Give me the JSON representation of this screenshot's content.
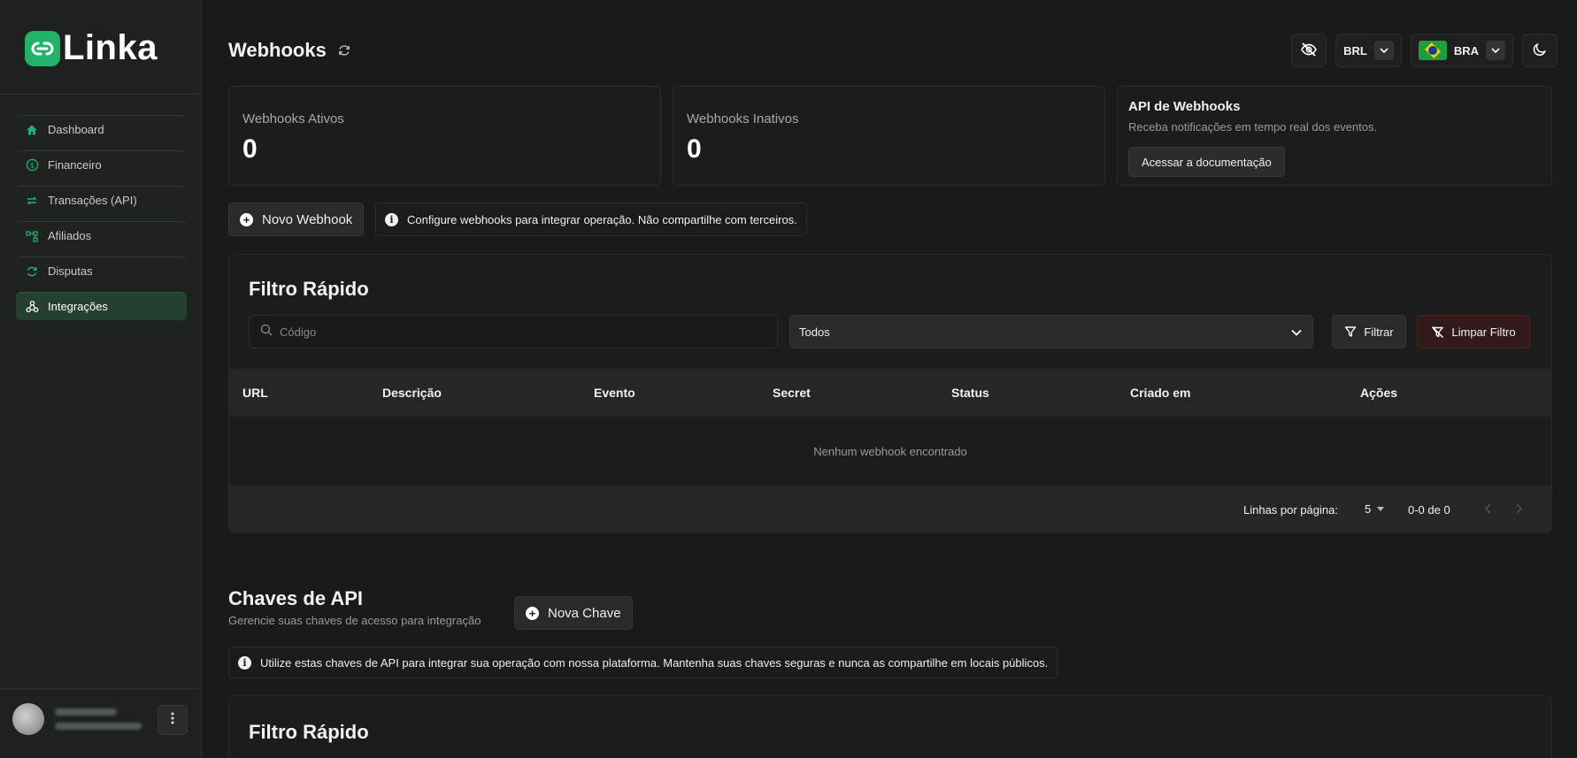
{
  "app": {
    "name": "Linka"
  },
  "sidebar": {
    "items": [
      {
        "label": "Dashboard",
        "icon": "home-icon"
      },
      {
        "label": "Financeiro",
        "icon": "dollar-circle-icon"
      },
      {
        "label": "Transações (API)",
        "icon": "swap-arrows-icon"
      },
      {
        "label": "Afiliados",
        "icon": "network-icon"
      },
      {
        "label": "Disputas",
        "icon": "refresh-icon"
      },
      {
        "label": "Integrações",
        "icon": "webhook-icon",
        "active": true
      }
    ]
  },
  "header": {
    "title": "Webhooks",
    "currency": "BRL",
    "country": "BRA"
  },
  "stats": [
    {
      "label": "Webhooks Ativos",
      "value": "0"
    },
    {
      "label": "Webhooks Inativos",
      "value": "0"
    }
  ],
  "api_card": {
    "title": "API de Webhooks",
    "subtitle": "Receba notificações em tempo real dos eventos.",
    "button": "Acessar a documentação"
  },
  "webhooks": {
    "new_button": "Novo Webhook",
    "notice": "Configure webhooks para integrar operação. Não compartilhe com terceiros."
  },
  "filter": {
    "title": "Filtro Rápido",
    "search_placeholder": "Código",
    "select_value": "Todos",
    "filter_button": "Filtrar",
    "clear_button": "Limpar Filtro"
  },
  "table": {
    "columns": [
      "URL",
      "Descrição",
      "Evento",
      "Secret",
      "Status",
      "Criado em",
      "Ações"
    ],
    "empty": "Nenhum webhook encontrado",
    "rows_label": "Linhas por página:",
    "rows_value": "5",
    "range": "0-0 de 0"
  },
  "api_keys": {
    "title": "Chaves de API",
    "subtitle": "Gerencie suas chaves de acesso para integração",
    "new_button": "Nova Chave",
    "notice": "Utilize estas chaves de API para integrar sua operação com nossa plataforma. Mantenha suas chaves seguras e nunca as compartilhe em locais públicos.",
    "filter_title": "Filtro Rápido"
  },
  "colors": {
    "accent": "#22b36b",
    "active_nav": "#24402f",
    "danger_bg": "#331a1a"
  }
}
